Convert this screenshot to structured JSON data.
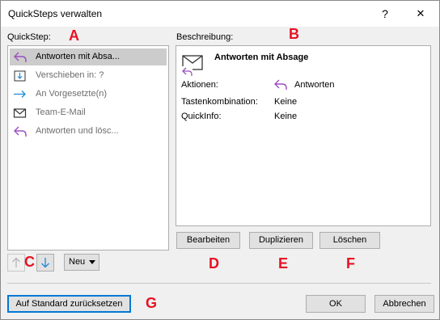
{
  "window": {
    "title": "QuickSteps verwalten",
    "help": "?",
    "close": "✕"
  },
  "list": {
    "label": "QuickStep:",
    "items": [
      {
        "label": "Antworten mit Absa...",
        "icon": "reply-icon",
        "selected": true
      },
      {
        "label": "Verschieben in: ?",
        "icon": "move-to-folder-icon"
      },
      {
        "label": "An Vorgesetzte(n)",
        "icon": "forward-arrow-icon"
      },
      {
        "label": "Team-E-Mail",
        "icon": "envelope-icon"
      },
      {
        "label": "Antworten und lösc...",
        "icon": "reply-icon"
      }
    ]
  },
  "description": {
    "label": "Beschreibung:",
    "name": "Antworten mit Absage",
    "actions_label": "Aktionen:",
    "actions_value": "Antworten",
    "shortcut_label": "Tastenkombination:",
    "shortcut_value": "Keine",
    "quickinfo_label": "QuickInfo:",
    "quickinfo_value": "Keine"
  },
  "buttons": {
    "edit": "Bearbeiten",
    "duplicate": "Duplizieren",
    "delete": "Löschen",
    "new": "Neu",
    "reset": "Auf Standard zurücksetzen",
    "ok": "OK",
    "cancel": "Abbrechen"
  },
  "annotations": {
    "A": "A",
    "B": "B",
    "C": "C",
    "D": "D",
    "E": "E",
    "F": "F",
    "G": "G"
  },
  "colors": {
    "accent": "#0078d7",
    "reply_icon": "#9b4fc0",
    "forward_icon": "#1f8ad6",
    "annotation": "#e81123"
  }
}
